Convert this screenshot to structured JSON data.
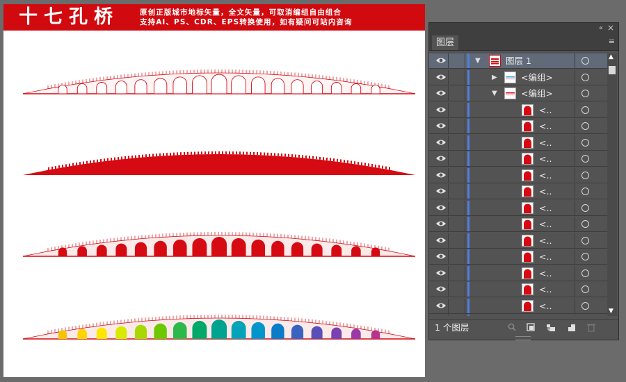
{
  "artboard": {
    "title": "十七孔桥",
    "description_line1": "原创正版城市地标矢量，全文矢量，可取消编组自由组合",
    "description_line2": "支持AI、PS、CDR、EPS转换使用，如有疑问可站内咨询",
    "banner_color": "#d10a10",
    "bridge_color": "#d60a12"
  },
  "panel": {
    "tab_label": "图层",
    "collapse_icon": "«",
    "close_icon": "×",
    "menu_icon": "≡",
    "layer_name": "图层 1",
    "group_name_1": "<编组>",
    "group_name_2": "<编组>",
    "child_label": "<..",
    "footer_count": "1 个图层",
    "accent_color": "#4f7fe0"
  }
}
